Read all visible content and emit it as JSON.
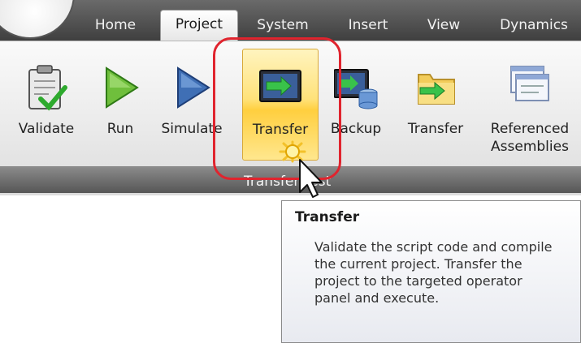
{
  "tabs": [
    {
      "label": "Home"
    },
    {
      "label": "Project"
    },
    {
      "label": "System"
    },
    {
      "label": "Insert"
    },
    {
      "label": "View"
    },
    {
      "label": "Dynamics"
    }
  ],
  "ribbon": {
    "buttons": [
      {
        "label": "Validate",
        "icon": "clipboard-check-icon"
      },
      {
        "label": "Run",
        "icon": "play-icon"
      },
      {
        "label": "Simulate",
        "icon": "simulate-play-icon"
      },
      {
        "label": "Transfer",
        "icon": "transfer-monitor-icon"
      },
      {
        "label": "Backup",
        "icon": "backup-database-icon"
      },
      {
        "label": "Transfer",
        "icon": "transfer-folder-icon"
      },
      {
        "label": "Referenced",
        "label2": "Assemblies",
        "icon": "referenced-assemblies-icon"
      }
    ],
    "group_label": "Transfer   Test"
  },
  "tooltip": {
    "title": "Transfer",
    "body": "Validate the script code and compile the current project. Transfer the project to the targeted operator panel and execute."
  },
  "colors": {
    "highlight_ring": "#e0242e",
    "hot_button": "#ffd54f"
  }
}
